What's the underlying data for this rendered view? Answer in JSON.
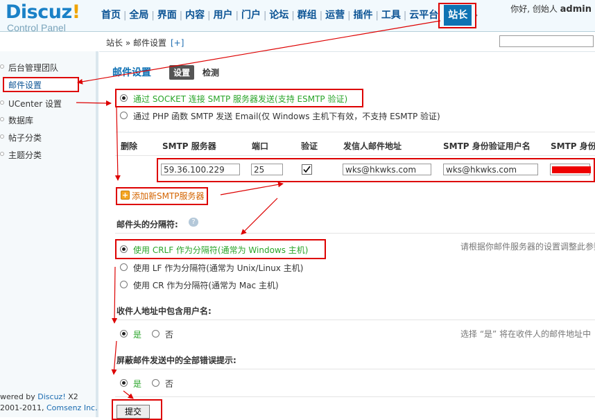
{
  "logo": {
    "brand_blue": "Discuz",
    "brand_orange": "!",
    "subtitle": "Control Panel"
  },
  "topnav": {
    "items": [
      "首页",
      "全局",
      "界面",
      "内容",
      "用户",
      "门户",
      "论坛",
      "群组",
      "运营",
      "插件",
      "工具",
      "云平台"
    ],
    "active": "站长",
    "more": "›"
  },
  "greeting": {
    "text": "你好, 创始人",
    "user": "admin"
  },
  "breadcrumb": {
    "text": "站长 » 邮件设置",
    "plus": "[+]"
  },
  "sidebar": {
    "items": [
      "后台管理团队",
      "邮件设置",
      "UCenter 设置",
      "数据库",
      "帖子分类",
      "主题分类"
    ],
    "footer_line1_prefix": "wered by ",
    "footer_line1_link": "Discuz!",
    "footer_line1_suffix": " X2",
    "footer_line2_prefix": "2001-2011, ",
    "footer_line2_link": "Comsenz Inc."
  },
  "main": {
    "title": "邮件设置",
    "tab_settings": "设置",
    "tab_check": "检测",
    "send_method": {
      "option_socket": "通过 SOCKET 连接 SMTP 服务器发送(支持 ESMTP 验证)",
      "option_php": "通过 PHP 函数 SMTP 发送 Email(仅 Windows 主机下有效，不支持 ESMTP 验证)"
    },
    "smtp_table": {
      "headers": [
        "删除",
        "SMTP 服务器",
        "端口",
        "验证",
        "发信人邮件地址",
        "SMTP 身份验证用户名",
        "SMTP 身份"
      ],
      "row": {
        "server": "59.36.100.229",
        "port": "25",
        "from": "wks@hkwks.com",
        "username": "wks@hkwks.com"
      },
      "add_server": "添加新SMTP服务器"
    },
    "separator": {
      "label": "邮件头的分隔符:",
      "options": [
        "使用 CRLF 作为分隔符(通常为 Windows 主机)",
        "使用 LF 作为分隔符(通常为 Unix/Linux 主机)",
        "使用 CR 作为分隔符(通常为 Mac 主机)"
      ],
      "hint": "请根据你邮件服务器的设置调整此参数"
    },
    "include_username": {
      "label": "收件人地址中包含用户名:",
      "yes": "是",
      "no": "否",
      "hint": "选择 “是” 将在收件人的邮件地址中"
    },
    "silence_errors": {
      "label": "屏蔽邮件发送中的全部错误提示:",
      "yes": "是",
      "no": "否"
    },
    "submit": "提交"
  },
  "colors": {
    "accent": "#0e73b3",
    "highlight": "#dd0000",
    "option_green": "#2aa52a"
  }
}
